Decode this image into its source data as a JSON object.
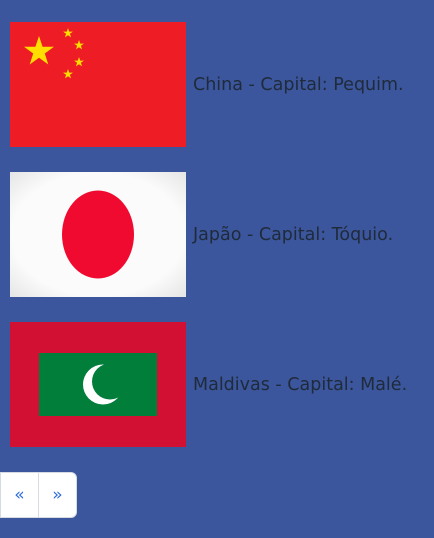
{
  "countries": [
    {
      "caption": "China - Capital: Pequim.",
      "flag_icon": "china-flag",
      "colors": {
        "field": "#ee1c25",
        "stars": "#ffde00"
      }
    },
    {
      "caption": "Japão - Capital: Tóquio.",
      "flag_icon": "japan-flag",
      "colors": {
        "field": "#f7f7f7",
        "disc": "#f00a2f"
      }
    },
    {
      "caption": "Maldivas - Capital: Malé.",
      "flag_icon": "maldives-flag",
      "colors": {
        "border": "#d21034",
        "center": "#007e3a",
        "crescent": "#ffffff"
      }
    }
  ],
  "pagination": {
    "prev_label": "«",
    "next_label": "»"
  },
  "theme": {
    "background": "#3b569c",
    "text": "#1f2a3a",
    "link": "#2d6cdf"
  }
}
